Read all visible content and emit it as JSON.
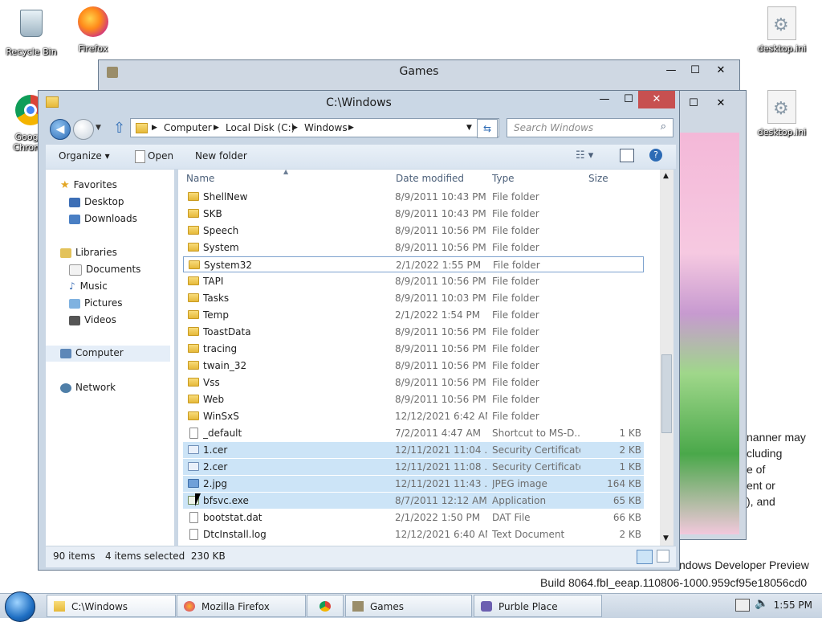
{
  "desktop": {
    "icons": [
      {
        "label": "Recycle Bin"
      },
      {
        "label": "Firefox"
      },
      {
        "label": "Google Chrome"
      },
      {
        "label": "desktop.ini"
      },
      {
        "label": "desktop.ini"
      }
    ],
    "watermark": {
      "line1": "ndows Developer Preview",
      "line2": "Build 8064.fbl_eeap.110806-1000.959cf95e18056cd0"
    },
    "behind_text": [
      "nanner may",
      "cluding",
      "e of",
      "ent or",
      "), and"
    ]
  },
  "games_window": {
    "title": "Games",
    "minimize": "—",
    "maximize": "☐",
    "close": "✕"
  },
  "purble_window": {
    "maximize": "☐",
    "close": "✕"
  },
  "explorer": {
    "title": "C:\\Windows",
    "minimize": "—",
    "maximize": "☐",
    "close": "✕",
    "address": {
      "crumbs": [
        "Computer",
        "Local Disk (C:)",
        "Windows"
      ]
    },
    "search_placeholder": "Search Windows",
    "toolbar": {
      "organize": "Organize ▾",
      "open": "Open",
      "new_folder": "New folder"
    },
    "nav": {
      "favorites": "Favorites",
      "desktop": "Desktop",
      "downloads": "Downloads",
      "libraries": "Libraries",
      "documents": "Documents",
      "music": "Music",
      "pictures": "Pictures",
      "videos": "Videos",
      "computer": "Computer",
      "network": "Network"
    },
    "columns": {
      "name": "Name",
      "date": "Date modified",
      "type": "Type",
      "size": "Size"
    },
    "rows": [
      {
        "name": "ShellNew",
        "date": "8/9/2011 10:43 PM",
        "type": "File folder",
        "size": "",
        "kind": "folder"
      },
      {
        "name": "SKB",
        "date": "8/9/2011 10:43 PM",
        "type": "File folder",
        "size": "",
        "kind": "folder"
      },
      {
        "name": "Speech",
        "date": "8/9/2011 10:56 PM",
        "type": "File folder",
        "size": "",
        "kind": "folder"
      },
      {
        "name": "System",
        "date": "8/9/2011 10:56 PM",
        "type": "File folder",
        "size": "",
        "kind": "folder"
      },
      {
        "name": "System32",
        "date": "2/1/2022 1:55 PM",
        "type": "File folder",
        "size": "",
        "kind": "folder"
      },
      {
        "name": "TAPI",
        "date": "8/9/2011 10:56 PM",
        "type": "File folder",
        "size": "",
        "kind": "folder"
      },
      {
        "name": "Tasks",
        "date": "8/9/2011 10:03 PM",
        "type": "File folder",
        "size": "",
        "kind": "folder"
      },
      {
        "name": "Temp",
        "date": "2/1/2022 1:54 PM",
        "type": "File folder",
        "size": "",
        "kind": "folder"
      },
      {
        "name": "ToastData",
        "date": "8/9/2011 10:56 PM",
        "type": "File folder",
        "size": "",
        "kind": "folder"
      },
      {
        "name": "tracing",
        "date": "8/9/2011 10:56 PM",
        "type": "File folder",
        "size": "",
        "kind": "folder"
      },
      {
        "name": "twain_32",
        "date": "8/9/2011 10:56 PM",
        "type": "File folder",
        "size": "",
        "kind": "folder"
      },
      {
        "name": "Vss",
        "date": "8/9/2011 10:56 PM",
        "type": "File folder",
        "size": "",
        "kind": "folder"
      },
      {
        "name": "Web",
        "date": "8/9/2011 10:56 PM",
        "type": "File folder",
        "size": "",
        "kind": "folder"
      },
      {
        "name": "WinSxS",
        "date": "12/12/2021 6:42 AM",
        "type": "File folder",
        "size": "",
        "kind": "folder"
      },
      {
        "name": "_default",
        "date": "7/2/2011 4:47 AM",
        "type": "Shortcut to MS-D...",
        "size": "1 KB",
        "kind": "shortcut"
      },
      {
        "name": "1.cer",
        "date": "12/11/2021 11:04 ...",
        "type": "Security Certificate",
        "size": "2 KB",
        "kind": "cert"
      },
      {
        "name": "2.cer",
        "date": "12/11/2021 11:08 ...",
        "type": "Security Certificate",
        "size": "1 KB",
        "kind": "cert"
      },
      {
        "name": "2.jpg",
        "date": "12/11/2021 11:43 ...",
        "type": "JPEG image",
        "size": "164 KB",
        "kind": "image"
      },
      {
        "name": "bfsvc.exe",
        "date": "8/7/2011 12:12 AM",
        "type": "Application",
        "size": "65 KB",
        "kind": "app"
      },
      {
        "name": "bootstat.dat",
        "date": "2/1/2022 1:50 PM",
        "type": "DAT File",
        "size": "66 KB",
        "kind": "file"
      },
      {
        "name": "DtcInstall.log",
        "date": "12/12/2021 6:40 AM",
        "type": "Text Document",
        "size": "2 KB",
        "kind": "file"
      }
    ],
    "status": {
      "count": "90 items",
      "selected": "4 items selected  230 KB"
    }
  },
  "taskbar": {
    "items": [
      {
        "label": "C:\\Windows"
      },
      {
        "label": "Mozilla Firefox"
      },
      {
        "label": ""
      },
      {
        "label": "Games"
      },
      {
        "label": "Purble Place"
      }
    ],
    "clock": "1:55 PM"
  }
}
